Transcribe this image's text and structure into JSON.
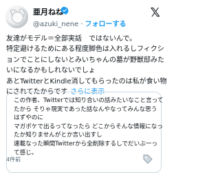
{
  "user": {
    "display_name": "亜月ねね",
    "handle": "@azuki_nene",
    "follow_label": "フォローする",
    "dot": "·",
    "verified_color": "#1d9bf0"
  },
  "platform_logo": "𝕏",
  "post": {
    "lines": [
      "友達がモデル＝全部実話　ではないんで。",
      "特定避けるためにある程度脚色は入れるしフィクシ",
      "ョンでことにしないとみいちゃんの墓が野獣邸みた",
      "いになるかもしれないでしょ",
      "あとTwitterとKindle消してもらったのは私が食い物",
      "にされてたからです"
    ],
    "read_more": "さらに表示"
  },
  "quoted": {
    "lines": [
      "この作者、Twitterでは知り合いの話みたいなこと言って",
      "たから そりゃ現実であった話なんやなってみんな思う",
      "はずやのに",
      "マガポケで出るってなったら どこからそんな情報になっ",
      "たか知りませんがとか言い出すし",
      "連載なった瞬間Twitterから全削除するしでだいぶ一っ",
      "て感じ。"
    ],
    "timestamp": "4件前"
  }
}
